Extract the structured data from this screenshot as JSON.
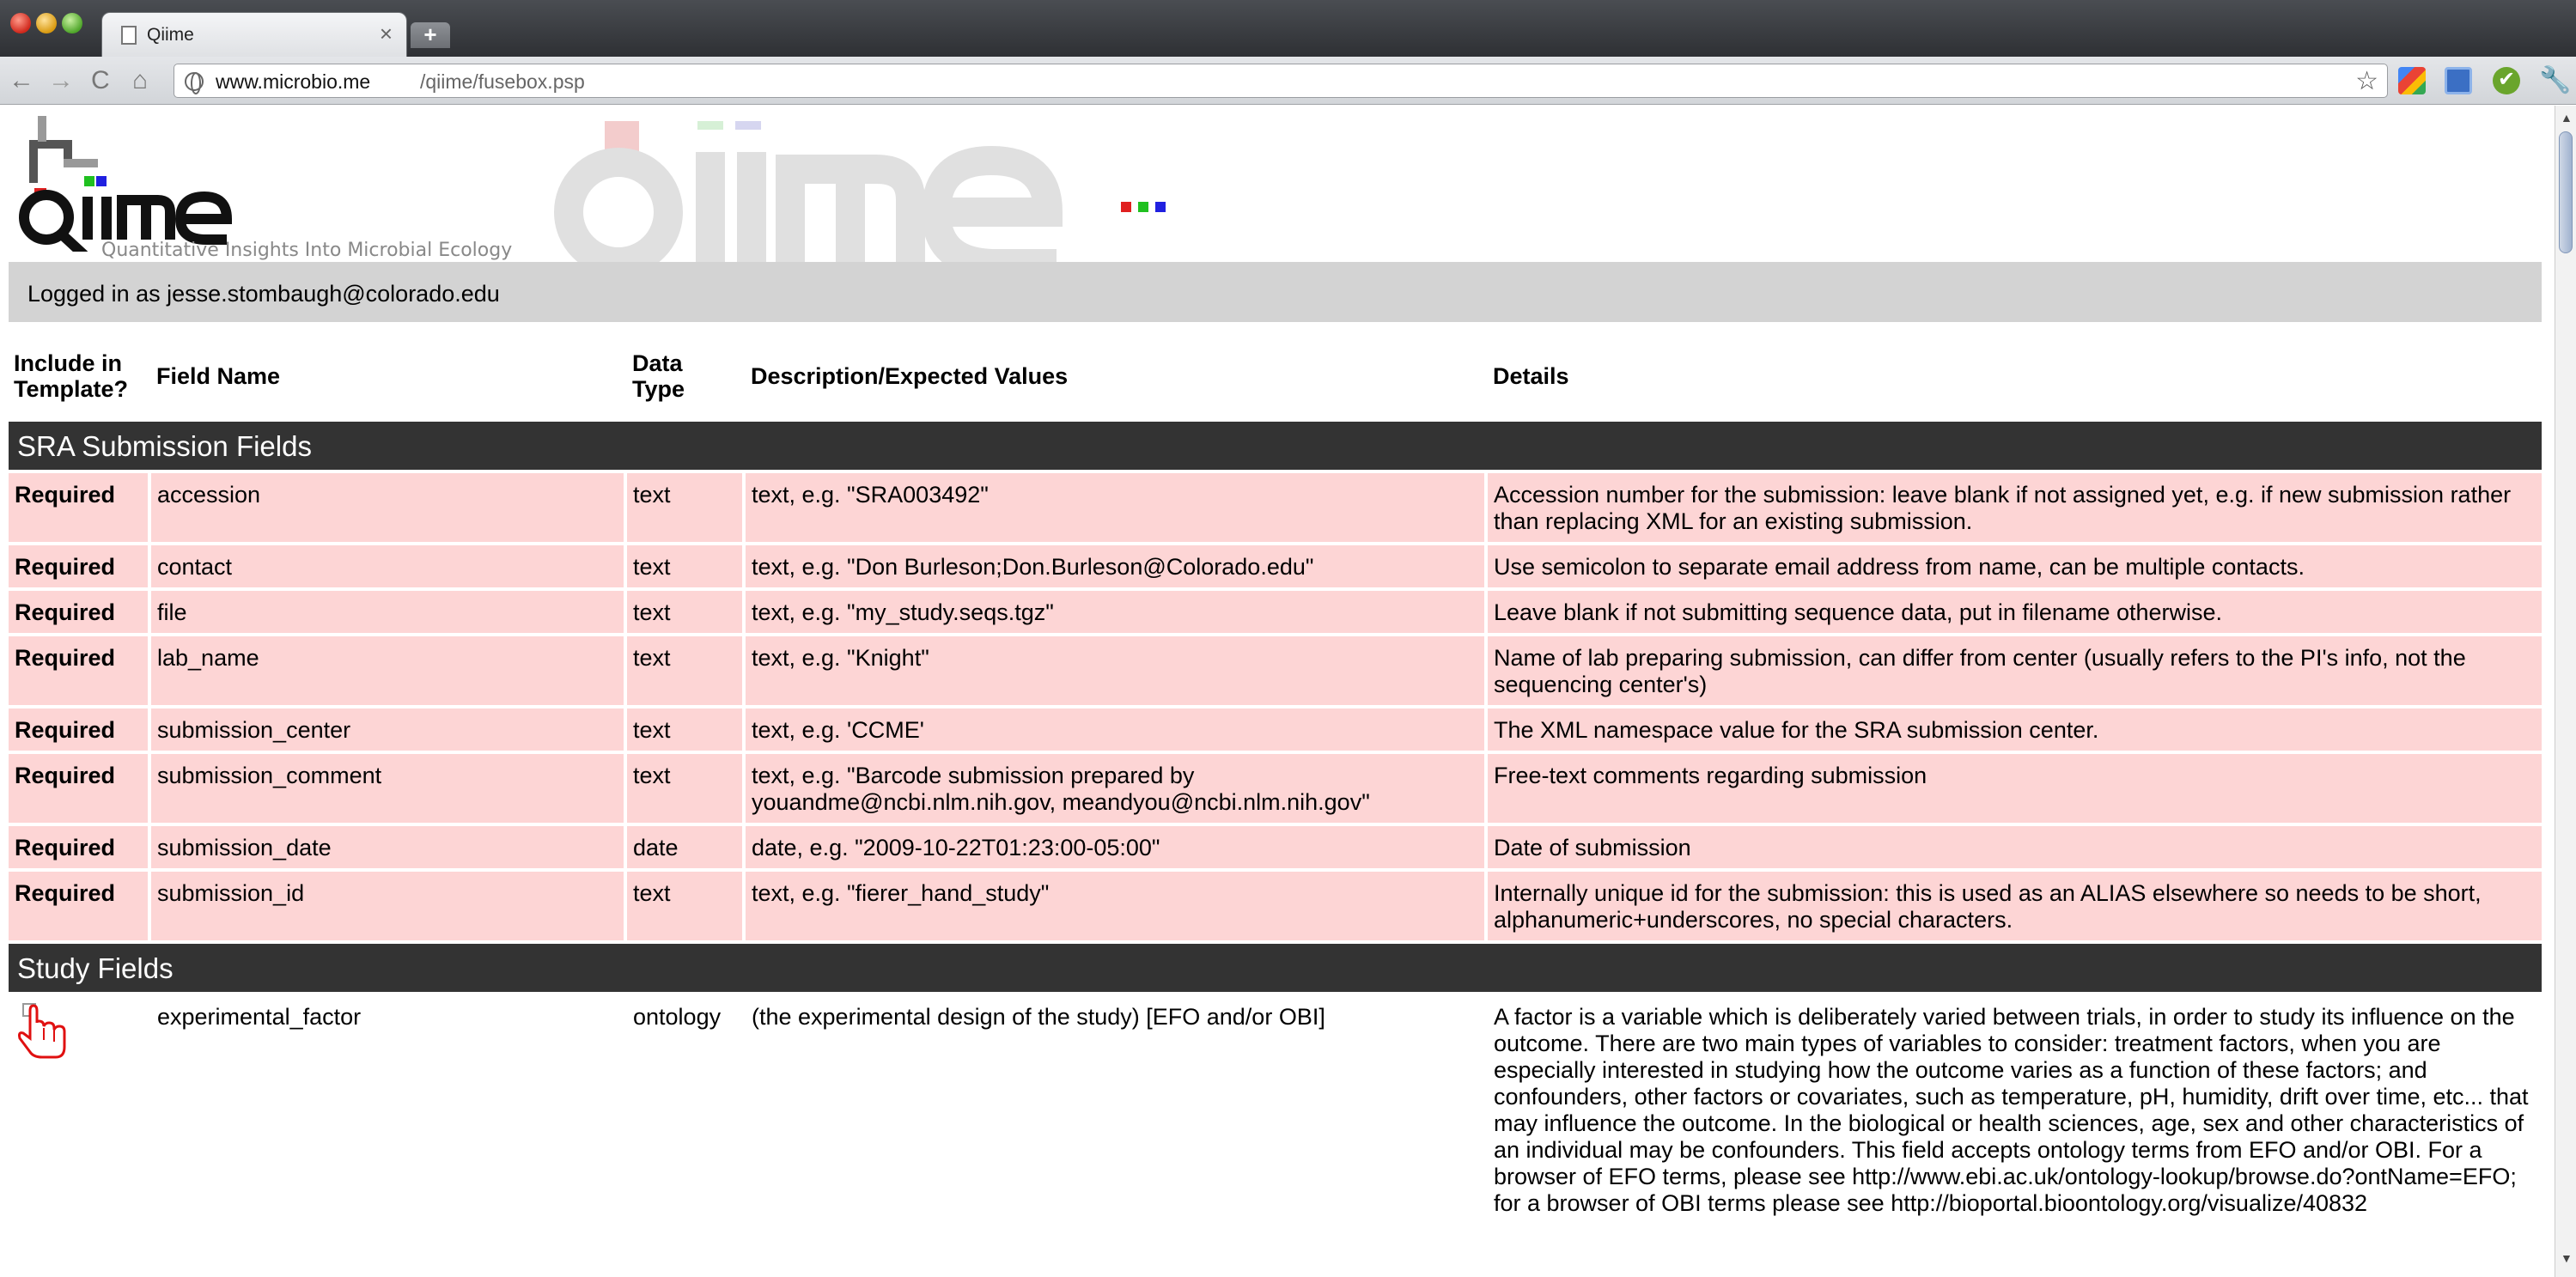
{
  "browser": {
    "tab_title": "Qiime",
    "tab_close": "×",
    "new_tab": "+",
    "url_host": "www.microbio.me",
    "url_path": "/qiime/fusebox.psp",
    "nav": {
      "back": "←",
      "forward": "→",
      "reload": "C",
      "home": "⌂",
      "star": "☆",
      "wrench": "🔧",
      "check": "✔"
    }
  },
  "header": {
    "logo_text": "qiime",
    "tagline": "Quantitative Insights Into Microbial Ecology",
    "watermark_text": "qiime",
    "login_text": "Logged in as jesse.stombaugh@colorado.edu"
  },
  "table": {
    "headers": {
      "include": "Include in Template?",
      "field": "Field Name",
      "type": "Data Type",
      "desc": "Description/Expected Values",
      "details": "Details"
    },
    "sections": [
      {
        "title": "SRA Submission Fields",
        "rows": [
          {
            "include": "Required",
            "field": "accession",
            "type": "text",
            "desc": "text, e.g. \"SRA003492\"",
            "details": "Accession number for the submission: leave blank if not assigned yet, e.g. if new submission rather than replacing XML for an existing submission."
          },
          {
            "include": "Required",
            "field": "contact",
            "type": "text",
            "desc": "text, e.g. \"Don Burleson;Don.Burleson@Colorado.edu\"",
            "details": "Use semicolon to separate email address from name, can be multiple contacts."
          },
          {
            "include": "Required",
            "field": "file",
            "type": "text",
            "desc": "text, e.g. \"my_study.seqs.tgz\"",
            "details": "Leave blank if not submitting sequence data, put in filename otherwise."
          },
          {
            "include": "Required",
            "field": "lab_name",
            "type": "text",
            "desc": "text, e.g. \"Knight\"",
            "details": "Name of lab preparing submission, can differ from center (usually refers to the PI's info, not the sequencing center's)"
          },
          {
            "include": "Required",
            "field": "submission_center",
            "type": "text",
            "desc": "text, e.g. 'CCME'",
            "details": "The XML namespace value for the SRA submission center."
          },
          {
            "include": "Required",
            "field": "submission_comment",
            "type": "text",
            "desc": "text, e.g. \"Barcode submission prepared by youandme@ncbi.nlm.nih.gov, meandyou@ncbi.nlm.nih.gov\"",
            "details": "Free-text comments regarding submission"
          },
          {
            "include": "Required",
            "field": "submission_date",
            "type": "date",
            "desc": "date, e.g. \"2009-10-22T01:23:00-05:00\"",
            "details": "Date of submission"
          },
          {
            "include": "Required",
            "field": "submission_id",
            "type": "text",
            "desc": "text, e.g. \"fierer_hand_study\"",
            "details": "Internally unique id for the submission: this is used as an ALIAS elsewhere so needs to be short, alphanumeric+underscores, no special characters."
          }
        ]
      },
      {
        "title": "Study Fields",
        "rows": [
          {
            "include": "",
            "field": "experimental_factor",
            "type": "ontology",
            "desc": "(the experimental design of the study) [EFO and/or OBI]",
            "details": "A factor is a variable which is deliberately varied between trials, in order to study its influence on the outcome. There are two main types of variables to consider: treatment factors, when you are especially interested in studying how the outcome varies as a function of these factors; and confounders, other factors or covariates, such as temperature, pH, humidity, drift over time, etc... that may influence the outcome. In the biological or health sciences, age, sex and other characteristics of an individual may be confounders. This field accepts ontology terms from EFO and/or OBI. For a browser of EFO terms, please see http://www.ebi.ac.uk/ontology-lookup/browse.do?ontName=EFO; for a browser of OBI terms please see http://bioportal.bioontology.org/visualize/40832"
          }
        ]
      }
    ]
  }
}
